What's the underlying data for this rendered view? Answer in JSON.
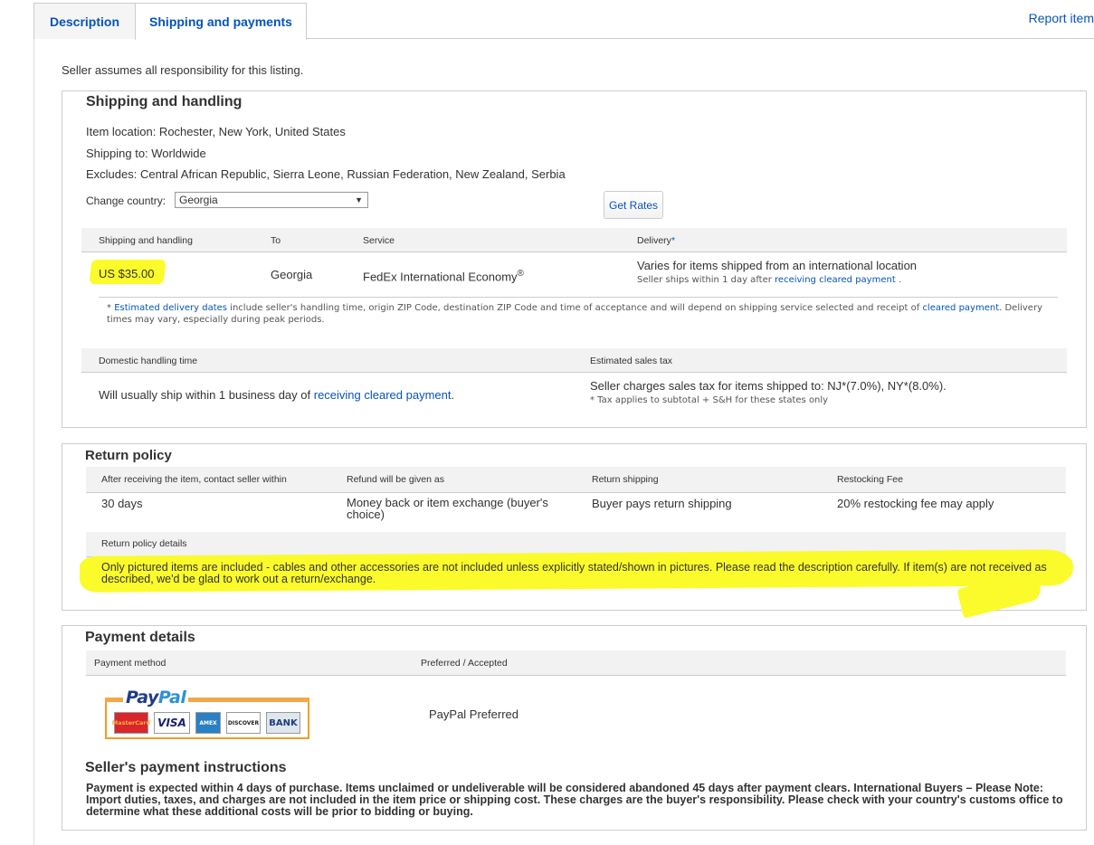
{
  "tabs": [
    {
      "label": "Description"
    },
    {
      "label": "Shipping and payments"
    }
  ],
  "report_link": "Report item",
  "responsibility": "Seller assumes all responsibility for this listing.",
  "shipping": {
    "title": "Shipping and handling",
    "item_location": "Item location: Rochester, New York, United States",
    "shipping_to": "Shipping to: Worldwide",
    "excludes": "Excludes: Central African Republic, Sierra Leone, Russian Federation, New Zealand, Serbia",
    "change_country_label": "Change country:",
    "country_selected": "Georgia",
    "get_rates": "Get Rates",
    "table_headers": {
      "shipping": "Shipping and handling",
      "to": "To",
      "service": "Service",
      "delivery": "Delivery",
      "delivery_mark": "*"
    },
    "row": {
      "price": "US $35.00",
      "to": "Georgia",
      "service": "FedEx International Economy",
      "service_mark": "®",
      "delivery": "Varies for items shipped from an international location",
      "delivery_note_prefix": "Seller ships within 1 day after",
      "delivery_note_link": "receiving cleared payment",
      "delivery_note_suffix": "."
    },
    "footnote": {
      "star": "*",
      "link1": "Estimated delivery dates",
      "text1": "include seller's handling time, origin ZIP Code, destination ZIP Code and time of acceptance and will depend on shipping service selected and receipt of",
      "link2": "cleared payment",
      "text2": ". Delivery times may vary, especially during peak periods."
    },
    "handling_header": "Domestic handling time",
    "tax_header": "Estimated sales tax",
    "handling_prefix": "Will usually ship within 1 business day of",
    "handling_link": "receiving cleared payment",
    "handling_suffix": ".",
    "tax_text": "Seller charges sales tax for items shipped to: NJ*(7.0%), NY*(8.0%).",
    "tax_note": "* Tax applies to subtotal + S&H for these states only"
  },
  "returns": {
    "title": "Return policy",
    "headers": [
      "After receiving the item, contact seller within",
      "Refund will be given as",
      "Return shipping",
      "Restocking Fee"
    ],
    "values": [
      "30 days",
      "Money back or item exchange (buyer's choice)",
      "Buyer pays return shipping",
      "20% restocking fee may apply"
    ],
    "details_header": "Return policy details",
    "details_text": "Only pictured items are included - cables and other accessories are not included unless explicitly stated/shown in pictures. Please read the description carefully. If item(s) are not received as described, we'd be glad to work out a return/exchange."
  },
  "payment": {
    "title": "Payment details",
    "method_header": "Payment method",
    "preferred_header": "Preferred / Accepted",
    "paypal_word_1": "Pay",
    "paypal_word_2": "Pal",
    "cards": [
      "MasterCard",
      "VISA",
      "AMEX",
      "DISCOVER",
      "BANK"
    ],
    "preferred_value": "PayPal Preferred",
    "instructions_title": "Seller's payment instructions",
    "instructions_text": "Payment is expected within 4 days of purchase. Items unclaimed or undeliverable will be considered abandoned 45 days after payment clears. International Buyers – Please Note: Import duties, taxes, and charges are not included in the item price or shipping cost. These charges are the buyer's responsibility. Please check with your country's customs office to determine what these additional costs will be prior to bidding or buying."
  },
  "colors": {
    "link": "#0654ba",
    "highlight": "#fbfb2b",
    "paypal_orange": "#f39c2b"
  }
}
